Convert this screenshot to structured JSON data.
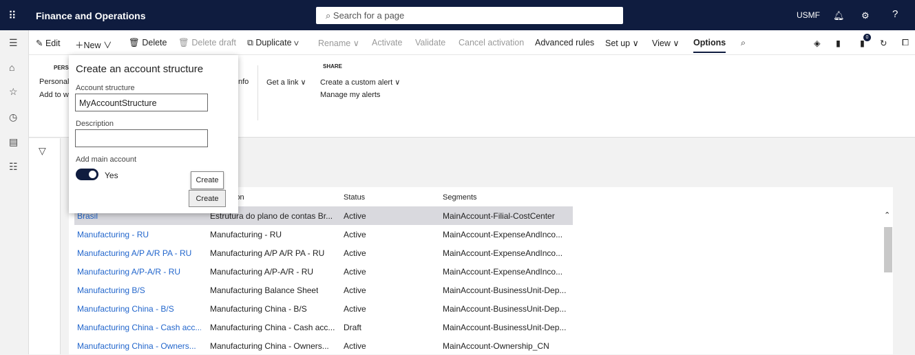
{
  "header": {
    "app_title": "Finance and Operations",
    "search_placeholder": "Search for a page",
    "company": "USMF"
  },
  "toolbar": {
    "edit": "Edit",
    "new": "New",
    "delete": "Delete",
    "delete_draft": "Delete draft",
    "duplicate": "Duplicate",
    "rename": "Rename",
    "activate": "Activate",
    "validate": "Validate",
    "cancel_activation": "Cancel activation",
    "advanced_rules": "Advanced rules",
    "set_up": "Set up",
    "view": "View",
    "options": "Options",
    "badge_count": "0"
  },
  "ribbon": {
    "pers_caption": "PERS",
    "personalize": "Personaliz",
    "add_to": "Add to w",
    "info": "nfo",
    "get_link": "Get a link",
    "share_caption": "SHARE",
    "custom_alert": "Create a custom alert",
    "manage_alerts": "Manage my alerts"
  },
  "dialog": {
    "title": "Create an account structure",
    "account_structure_label": "Account structure",
    "account_structure_value": "MyAccountStructure",
    "description_label": "Description",
    "description_value": "",
    "add_main_label": "Add main account",
    "add_main_value": "Yes",
    "add_main_on": true,
    "create_tooltip": "Create",
    "create_button": "Create"
  },
  "grid": {
    "columns": [
      "ion",
      "Status",
      "Segments"
    ],
    "rows": [
      {
        "name": "Brasil",
        "description": "Estrutura do plano de contas Br...",
        "status": "Active",
        "segments": "MainAccount-Filial-CostCenter"
      },
      {
        "name": "Manufacturing - RU",
        "description": "Manufacturing - RU",
        "status": "Active",
        "segments": "MainAccount-ExpenseAndInco..."
      },
      {
        "name": "Manufacturing A/P A/R PA - RU",
        "description": "Manufacturing A/P A/R PA - RU",
        "status": "Active",
        "segments": "MainAccount-ExpenseAndInco..."
      },
      {
        "name": "Manufacturing A/P-A/R - RU",
        "description": "Manufacturing A/P-A/R - RU",
        "status": "Active",
        "segments": "MainAccount-ExpenseAndInco..."
      },
      {
        "name": "Manufacturing B/S",
        "description": "Manufacturing Balance Sheet",
        "status": "Active",
        "segments": "MainAccount-BusinessUnit-Dep..."
      },
      {
        "name": "Manufacturing China - B/S",
        "description": "Manufacturing China - B/S",
        "status": "Active",
        "segments": "MainAccount-BusinessUnit-Dep..."
      },
      {
        "name": "Manufacturing China - Cash acc...",
        "description": "Manufacturing China - Cash acc...",
        "status": "Draft",
        "segments": "MainAccount-BusinessUnit-Dep..."
      },
      {
        "name": "Manufacturing China - Owners...",
        "description": "Manufacturing China - Owners...",
        "status": "Active",
        "segments": "MainAccount-Ownership_CN"
      }
    ]
  }
}
